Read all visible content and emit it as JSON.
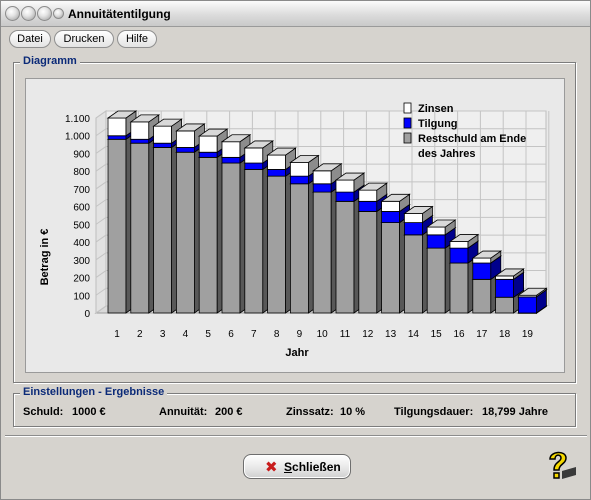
{
  "window": {
    "title": "Annuitätentilgung"
  },
  "menu": {
    "items": [
      "Datei",
      "Drucken",
      "Hilfe"
    ]
  },
  "diagram_group": {
    "label": "Diagramm"
  },
  "settings_group": {
    "label": "Einstellungen - Ergebnisse"
  },
  "results": {
    "schuld_label": "Schuld:",
    "schuld_value": "1000 €",
    "annuitaet_label": "Annuität:",
    "annuitaet_value": "200 €",
    "zinssatz_label": "Zinssatz:",
    "zinssatz_value": "10 %",
    "dauer_label": "Tilgungsdauer:",
    "dauer_value": "18,799 Jahre"
  },
  "buttons": {
    "close_accel": "S",
    "close_rest": "chließen"
  },
  "icons": {
    "close": "x-icon",
    "help": "help-question-icon",
    "window_buttons": "orb-icon"
  },
  "colors": {
    "zinsen": "#ffffff",
    "tilgung": "#0000ff",
    "restschuld": "#a0a0a0",
    "group_label": "#0b2a78"
  },
  "chart_data": {
    "type": "bar",
    "stacked": true,
    "three_d": true,
    "xlabel": "Jahr",
    "ylabel": "Betrag in €",
    "ylim": [
      0,
      1100
    ],
    "yticks": [
      "0",
      "100",
      "200",
      "300",
      "400",
      "500",
      "600",
      "700",
      "800",
      "900",
      "1.000",
      "1.100"
    ],
    "categories": [
      "1",
      "2",
      "3",
      "4",
      "5",
      "6",
      "7",
      "8",
      "9",
      "10",
      "11",
      "12",
      "13",
      "14",
      "15",
      "16",
      "17",
      "18",
      "19"
    ],
    "legend_position": "top-right",
    "grid": true,
    "series": [
      {
        "name": "Restschuld am Ende des Jahres",
        "color": "#a0a0a0",
        "values": [
          980,
          958,
          934,
          907,
          878,
          846,
          810,
          772,
          729,
          682,
          630,
          573,
          510,
          441,
          366,
          282,
          190,
          89,
          -2
        ]
      },
      {
        "name": "Tilgung",
        "color": "#0000ff",
        "values": [
          20,
          22,
          24,
          27,
          29,
          32,
          36,
          38,
          43,
          47,
          52,
          57,
          63,
          69,
          75,
          84,
          92,
          101,
          91
        ]
      },
      {
        "name": "Zinsen",
        "color": "#ffffff",
        "values": [
          100,
          98,
          96,
          93,
          91,
          88,
          85,
          81,
          77,
          73,
          68,
          63,
          57,
          51,
          44,
          37,
          28,
          19,
          9
        ]
      }
    ],
    "legend": [
      {
        "label": "Zinsen",
        "color": "#ffffff"
      },
      {
        "label": "Tilgung",
        "color": "#0000ff"
      },
      {
        "label": "Restschuld am Ende",
        "color": "#a0a0a0"
      },
      {
        "label": "des Jahres",
        "color": ""
      }
    ]
  }
}
